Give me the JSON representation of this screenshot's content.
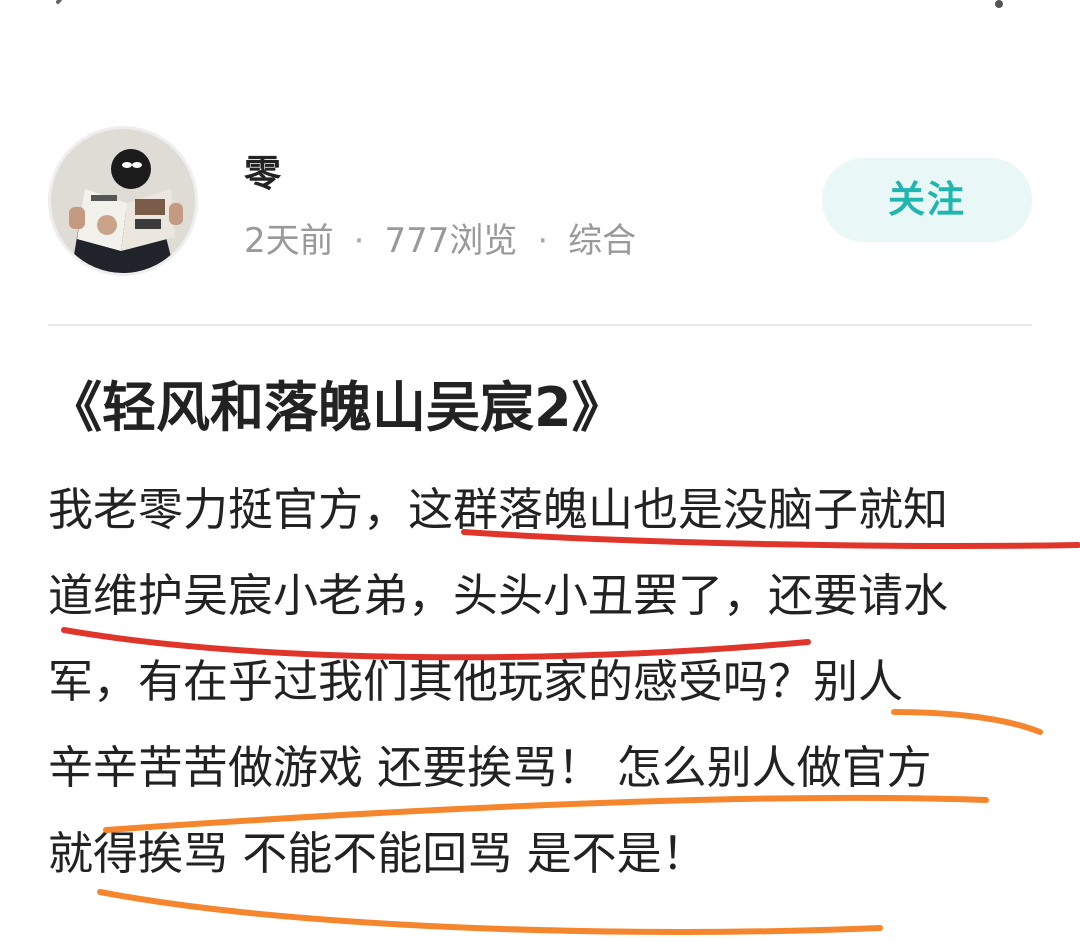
{
  "header": {
    "back_icon": "chevron-left-icon",
    "more_icon": "more-dots-icon"
  },
  "author": {
    "name": "零",
    "time_ago": "2天前",
    "views": "777浏览",
    "category": "综合",
    "separator": "·",
    "follow_label": "关注",
    "avatar_icon": "avatar-photo"
  },
  "post": {
    "title": "《轻风和落魄山吴宸2》",
    "body_lines": [
      "我老零力挺官方，这群落魄山也是没脑子就知",
      "道维护吴宸小老弟，头头小丑罢了，还要请水",
      "军，有在乎过我们其他玩家的感受吗？别人",
      "辛辛苦苦做游戏 还要挨骂！ 怎么别人做官方",
      "就得挨骂 不能不能回骂 是不是！"
    ]
  },
  "colors": {
    "accent": "#1fb6ad",
    "follow_bg": "#e9f7f6",
    "red_markup": "#e0352b",
    "orange_markup": "#f5862e",
    "meta_text": "#999999"
  }
}
